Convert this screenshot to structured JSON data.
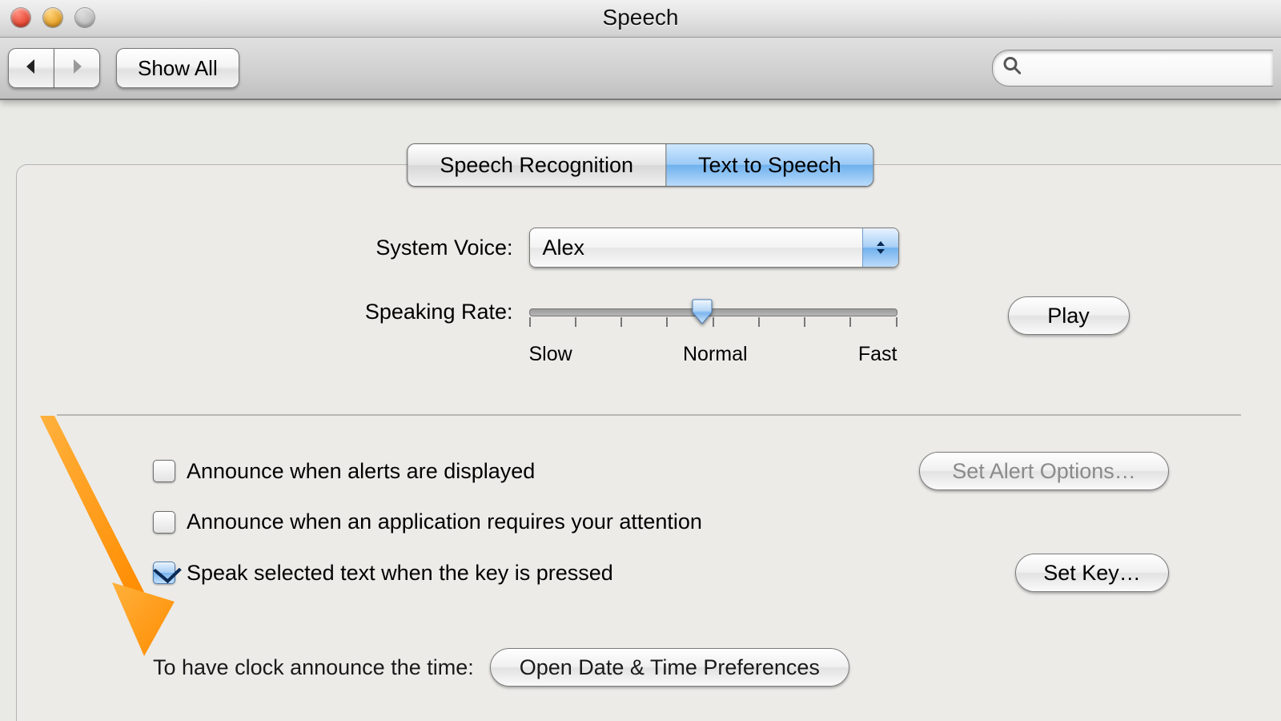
{
  "window": {
    "title": "Speech"
  },
  "toolbar": {
    "show_all_label": "Show All",
    "search_placeholder": ""
  },
  "tabs": {
    "speech_recognition": "Speech Recognition",
    "text_to_speech": "Text to Speech"
  },
  "voice": {
    "label": "System Voice:",
    "value": "Alex"
  },
  "rate": {
    "label": "Speaking Rate:",
    "slow": "Slow",
    "normal": "Normal",
    "fast": "Fast",
    "play_label": "Play"
  },
  "options": {
    "announce_alerts": "Announce when alerts are displayed",
    "announce_app_attention": "Announce when an application requires your attention",
    "speak_selected": "Speak selected text when the key is pressed",
    "set_alert_options": "Set Alert Options…",
    "set_key": "Set Key…"
  },
  "clock": {
    "label": "To have clock announce the time:",
    "button": "Open Date & Time Preferences"
  }
}
